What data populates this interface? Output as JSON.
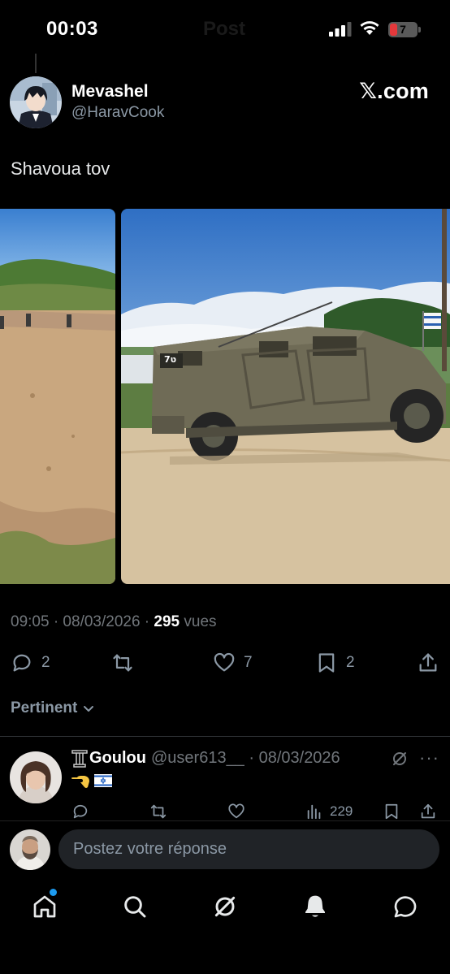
{
  "status_bar": {
    "time": "00:03",
    "header_title": "Post",
    "battery_level": "7"
  },
  "post": {
    "author_name": "Mevashel",
    "author_handle": "@HaravCook",
    "brand": "𝕏.com",
    "text": "Shavoua tov",
    "vehicle_plate": "7ט",
    "timestamp": "09:05 · 08/03/2026 · ",
    "views_count": "295",
    "views_label": " vues",
    "stats": {
      "replies": "2",
      "reposts": "",
      "likes": "7",
      "bookmarks": "2"
    }
  },
  "sort": {
    "label": "Pertinent"
  },
  "reply": {
    "name": "Goulou",
    "handle_date": "@user613__ · 08/03/2026",
    "more": "···",
    "views": "229"
  },
  "compose": {
    "placeholder": "Postez votre réponse"
  },
  "colors": {
    "background": "#000000",
    "accent": "#1d9bf0",
    "secondary_text": "#71767b",
    "battery_red": "#e5383b"
  },
  "icons": {
    "reply": "reply-icon",
    "repost": "repost-icon",
    "like": "heart-icon",
    "bookmark": "bookmark-icon",
    "share": "share-icon",
    "home": "home-icon",
    "search": "search-icon",
    "grok": "grok-icon",
    "notifications": "bell-icon",
    "messages": "message-icon"
  }
}
